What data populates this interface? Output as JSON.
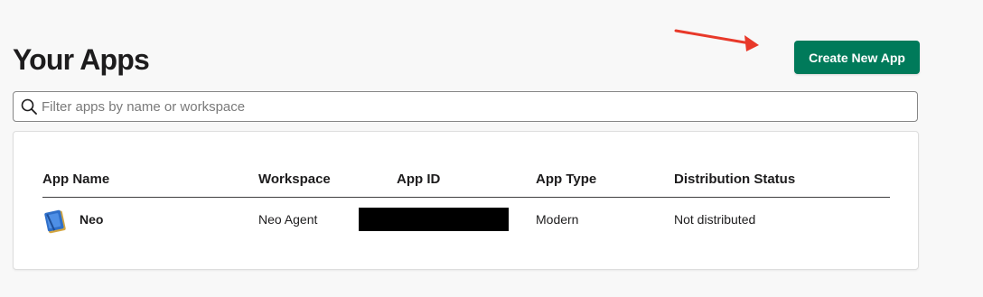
{
  "header": {
    "title": "Your Apps",
    "create_button_label": "Create New App"
  },
  "search": {
    "placeholder": "Filter apps by name or workspace",
    "value": "",
    "icon": "search-icon"
  },
  "table": {
    "columns": [
      "App Name",
      "Workspace",
      "App ID",
      "App Type",
      "Distribution Status"
    ],
    "rows": [
      {
        "icon": "app-notebook-icon",
        "app_name": "Neo",
        "workspace": "Neo Agent",
        "app_id": "",
        "app_id_redacted": true,
        "app_type": "Modern",
        "distribution_status": "Not distributed"
      }
    ]
  },
  "annotation": {
    "arrow_color": "#e8392a",
    "arrow_target": "create-new-app-button"
  },
  "colors": {
    "page_background": "#f8f8f8",
    "primary_button": "#007a5a",
    "text": "#1d1c1d"
  }
}
